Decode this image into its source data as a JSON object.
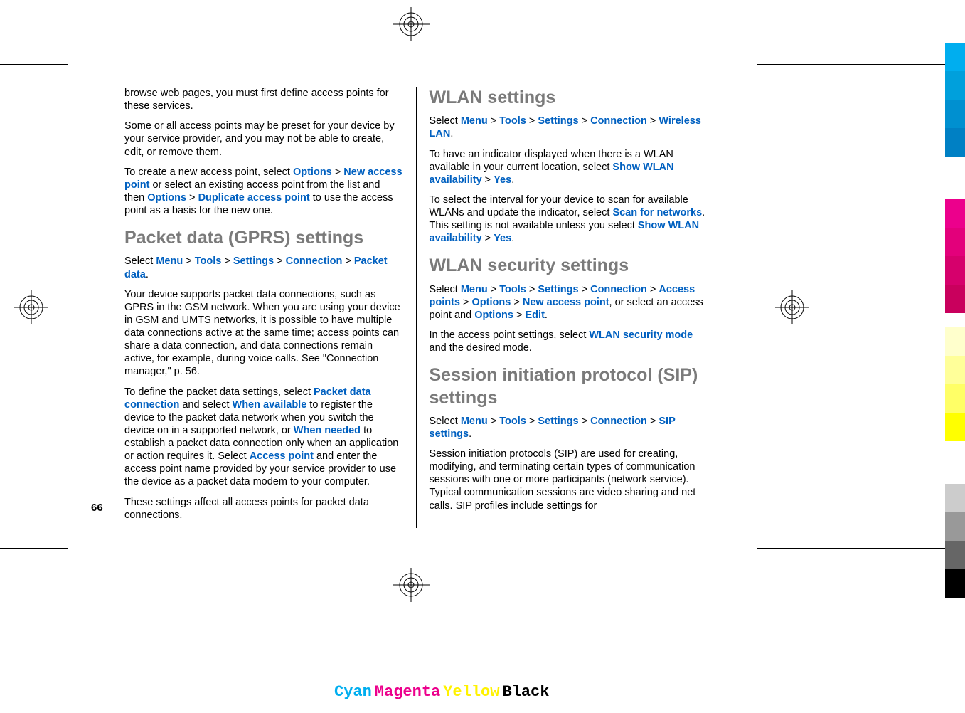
{
  "page_number": "66",
  "left": {
    "p1": "browse web pages, you must first define access points for these services.",
    "p2": "Some or all access points may be preset for your device by your service provider, and you may not be able to create, edit, or remove them.",
    "p3a": "To create a new access point, select ",
    "p3_opt": "Options",
    "p3_gt1": " > ",
    "p3_new": "New access point",
    "p3b": " or select an existing access point from the list and then ",
    "p3_opt2": "Options",
    "p3_gt2": " > ",
    "p3_dup": "Duplicate access point",
    "p3c": " to use the access point as a basis for the new one.",
    "h1": "Packet data (GPRS) settings",
    "p4a": "Select ",
    "p4_menu": "Menu",
    "p4_gt1": " > ",
    "p4_tools": "Tools",
    "p4_gt2": " > ",
    "p4_settings": "Settings",
    "p4_gt3": " > ",
    "p4_conn": "Connection",
    "p4_gt4": " > ",
    "p4_pd": "Packet data",
    "p4b": ".",
    "p5": "Your device supports packet data connections, such as GPRS in the GSM network. When you are using your device in GSM and UMTS networks, it is possible to have multiple data connections active at the same time; access points can share a data connection, and data connections remain active, for example, during voice calls. See \"Connection manager,\" p. 56.",
    "p6a": "To define the packet data settings, select ",
    "p6_pdc": "Packet data connection",
    "p6b": " and select ",
    "p6_wa": "When available",
    "p6c": " to register the device to the packet data network when you switch the device on in a supported network, or ",
    "p6_wn": "When needed",
    "p6d": " to establish a packet data connection only when an application or action requires it. Select ",
    "p6_ap": "Access point",
    "p6e": " and enter the access point name provided by your service provider to use the device as a packet data modem to your computer.",
    "p7": "These settings affect all access points for packet data connections."
  },
  "right": {
    "h1": "WLAN settings",
    "p1a": "Select ",
    "p1_menu": "Menu",
    "p1_gt1": " > ",
    "p1_tools": "Tools",
    "p1_gt2": " > ",
    "p1_set": "Settings",
    "p1_gt3": " > ",
    "p1_conn": "Connection",
    "p1_gt4": " > ",
    "p1_wl": "Wireless LAN",
    "p1b": ".",
    "p2a": "To have an indicator displayed when there is a WLAN available in your current location, select ",
    "p2_swa": "Show WLAN availability",
    "p2_gt": " > ",
    "p2_yes": "Yes",
    "p2b": ".",
    "p3a": "To select the interval for your device to scan for available WLANs and update the indicator, select ",
    "p3_sfn": "Scan for networks",
    "p3b": ". This setting is not available unless you select ",
    "p3_swa": "Show WLAN availability",
    "p3_gt": " > ",
    "p3_yes": "Yes",
    "p3c": ".",
    "h2": "WLAN security settings",
    "p4a": "Select ",
    "p4_menu": "Menu",
    "p4_gt1": " > ",
    "p4_tools": "Tools",
    "p4_gt2": " > ",
    "p4_set": "Settings",
    "p4_gt3": " > ",
    "p4_conn": "Connection",
    "p4_gt4": " > ",
    "p4_ap": "Access points",
    "p4_gt5": " > ",
    "p4_opt": "Options",
    "p4_gt6": " > ",
    "p4_nap": "New access point",
    "p4b": ", or select an access point and ",
    "p4_opt2": "Options",
    "p4_gt7": " > ",
    "p4_edit": "Edit",
    "p4c": ".",
    "p5a": "In the access point settings, select ",
    "p5_wsm": "WLAN security mode",
    "p5b": " and the desired mode.",
    "h3": "Session initiation protocol (SIP) settings",
    "p6a": "Select ",
    "p6_menu": "Menu",
    "p6_gt1": " > ",
    "p6_tools": "Tools",
    "p6_gt2": " > ",
    "p6_set": "Settings",
    "p6_gt3": " > ",
    "p6_conn": "Connection",
    "p6_gt4": " > ",
    "p6_sip": "SIP settings",
    "p6b": ".",
    "p7": "Session initiation protocols (SIP) are used for creating, modifying, and terminating certain types of communication sessions with one or more participants (network service). Typical communication sessions are video sharing and net calls. SIP profiles include settings for"
  },
  "colors": {
    "cyan": "Cyan",
    "magenta": "Magenta",
    "yellow": "Yellow",
    "black": "Black"
  }
}
